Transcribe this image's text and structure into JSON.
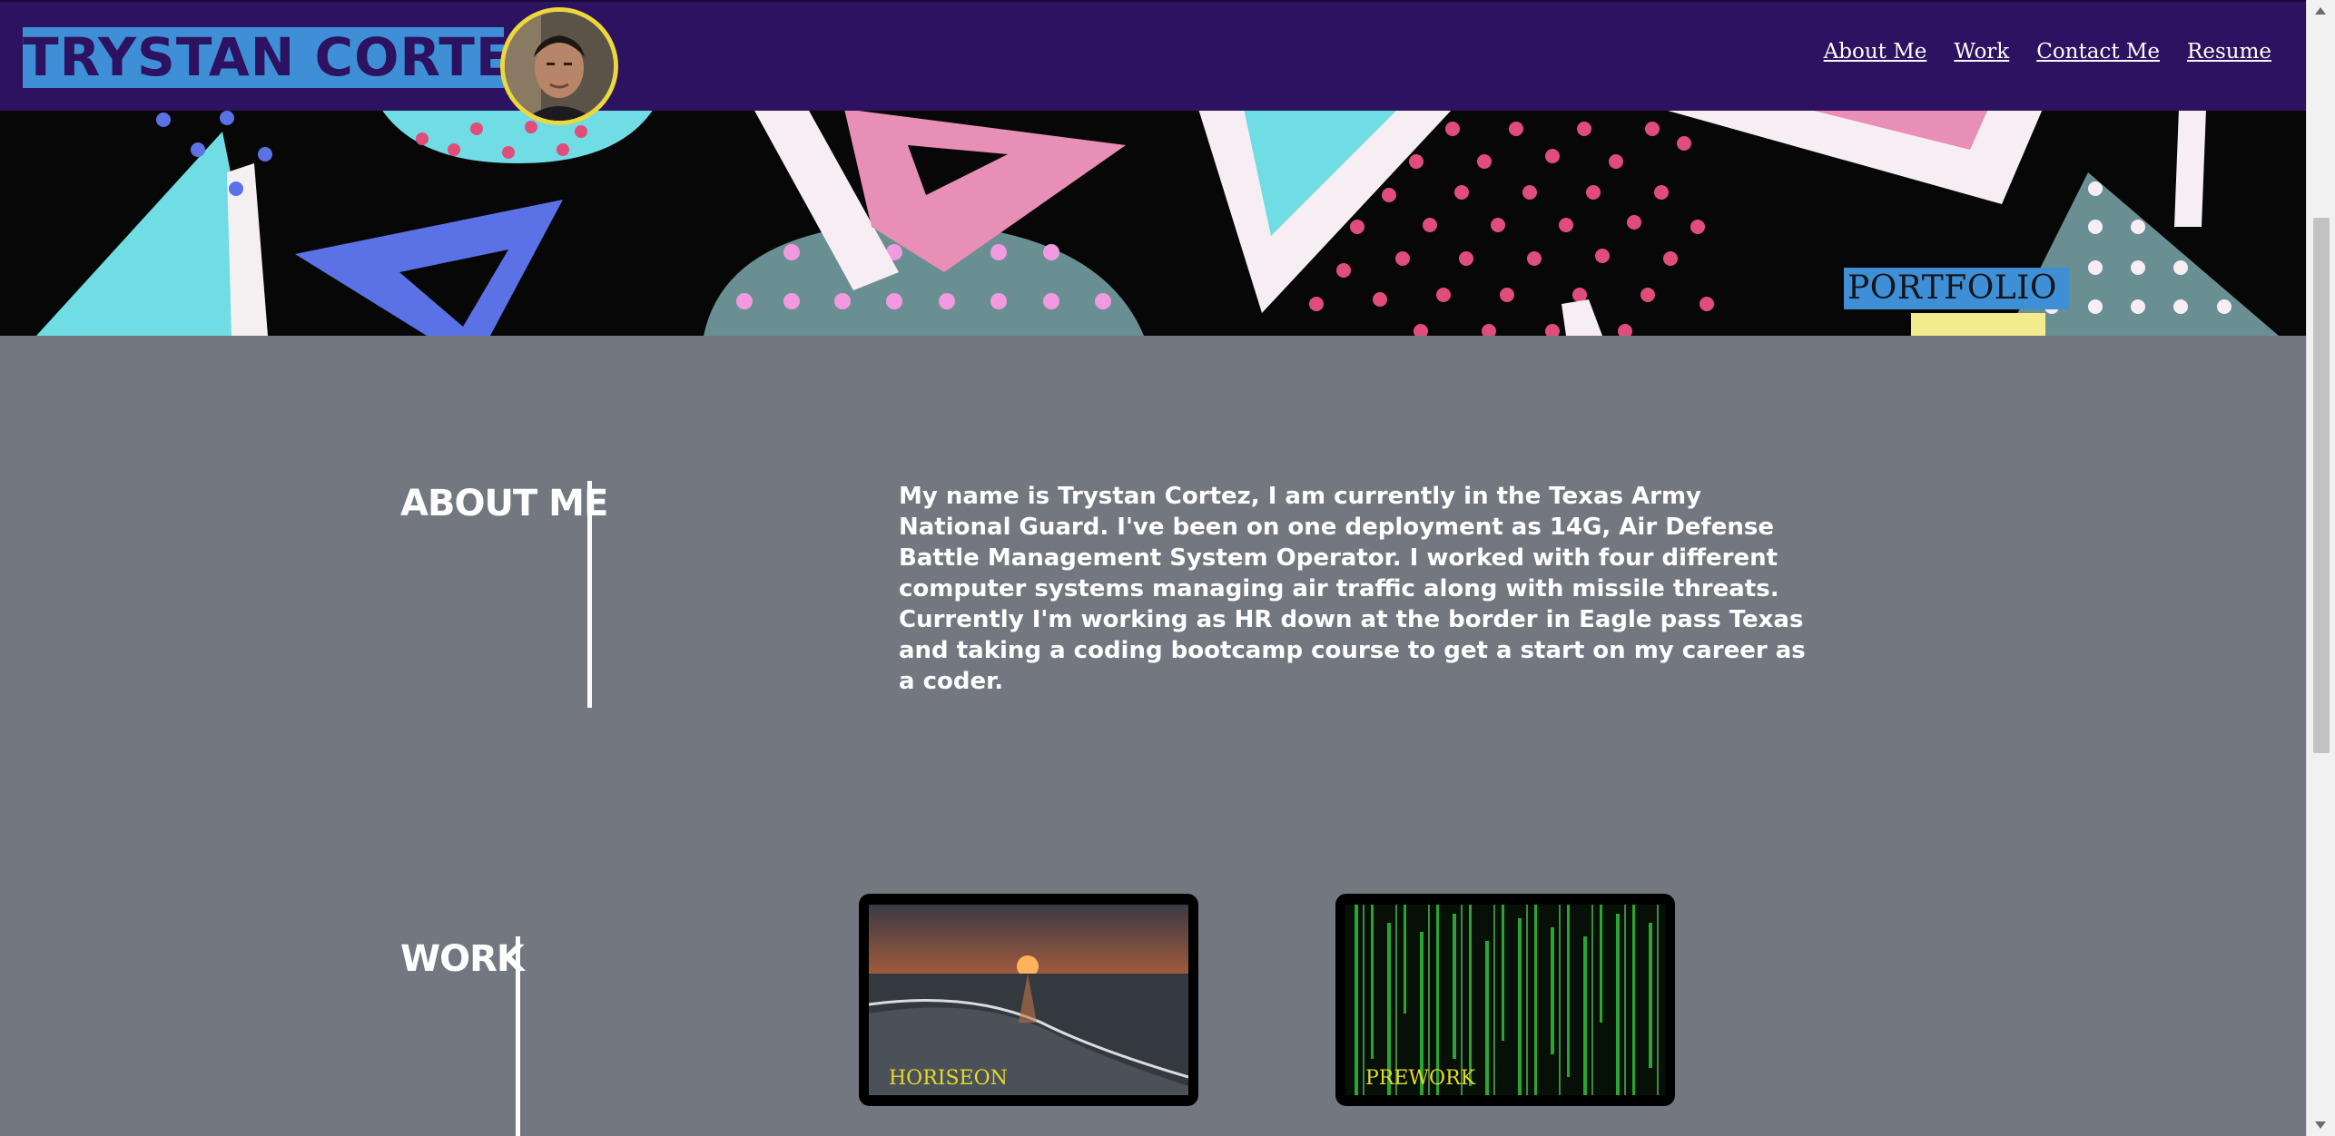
{
  "header": {
    "name": "TRYSTAN CORTEZ",
    "nav": [
      {
        "label": "About Me"
      },
      {
        "label": "Work"
      },
      {
        "label": "Contact Me"
      },
      {
        "label": "Resume"
      }
    ]
  },
  "hero": {
    "badge": "PORTFOLIO"
  },
  "about": {
    "title": "ABOUT ME",
    "text": "My name is Trystan Cortez, I am currently in the Texas Army National Guard. I've been on one deployment as 14G, Air Defense Battle Management System Operator. I worked with four different computer systems managing air traffic along with missile threats. Currently I'm working as HR down at the border in Eagle pass Texas and taking a coding bootcamp course to get a start on my career as a coder."
  },
  "work": {
    "title": "WORK",
    "projects": [
      {
        "label": "HORISEON"
      },
      {
        "label": "PREWORK"
      }
    ]
  },
  "colors": {
    "header_bg": "#2c1260",
    "accent_blue": "#3f8fd6",
    "avatar_ring": "#ecd83c",
    "page_bg": "#737780",
    "card_label": "#e6d92a"
  }
}
